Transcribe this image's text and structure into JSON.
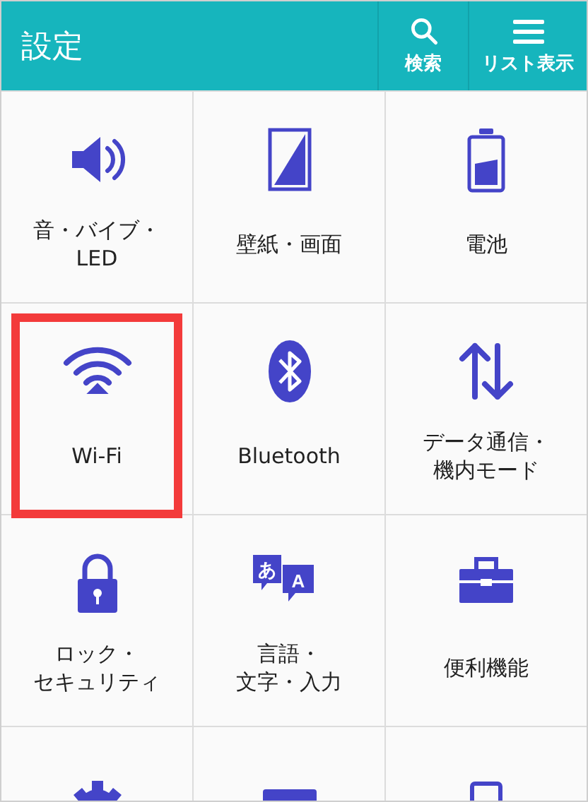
{
  "header": {
    "title": "設定",
    "actions": [
      {
        "kind": "search",
        "label": "検索"
      },
      {
        "kind": "list",
        "label": "リスト表示"
      }
    ]
  },
  "tiles": [
    {
      "kind": "sound",
      "lines": [
        "音・バイブ・",
        "LED"
      ],
      "highlighted": false
    },
    {
      "kind": "wallpaper",
      "lines": [
        "壁紙・画面"
      ],
      "highlighted": false
    },
    {
      "kind": "battery",
      "lines": [
        "電池"
      ],
      "highlighted": false
    },
    {
      "kind": "wifi",
      "lines": [
        "Wi-Fi"
      ],
      "highlighted": true
    },
    {
      "kind": "bluetooth",
      "lines": [
        "Bluetooth"
      ],
      "highlighted": false
    },
    {
      "kind": "data",
      "lines": [
        "データ通信・",
        "機内モード"
      ],
      "highlighted": false
    },
    {
      "kind": "lock",
      "lines": [
        "ロック・",
        "セキュリティ"
      ],
      "highlighted": false
    },
    {
      "kind": "language",
      "lines": [
        "言語・",
        "文字・入力"
      ],
      "highlighted": false,
      "glyphs": [
        "あ",
        "A"
      ]
    },
    {
      "kind": "toolbox",
      "lines": [
        "便利機能"
      ],
      "highlighted": false
    },
    {
      "kind": "gear"
    },
    {
      "kind": "card"
    },
    {
      "kind": "phone"
    }
  ]
}
